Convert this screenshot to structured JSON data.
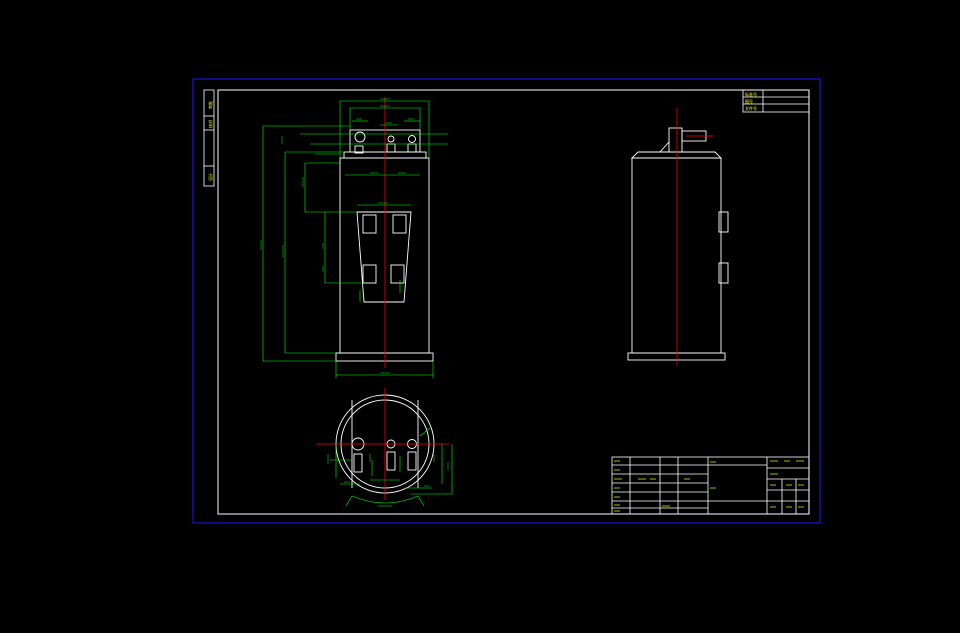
{
  "drawing": {
    "colors": {
      "background": "#000000",
      "sheet_border": "#1a1aff",
      "frame": "#ffffff",
      "dimension": "#00ff00",
      "centerline": "#ff0000",
      "text": "#ffff00"
    },
    "title_block": {
      "top_right_box": [
        "标准号",
        "图号",
        "文件号"
      ]
    },
    "left_strip": [
      "审批",
      "核对",
      "设计"
    ]
  }
}
